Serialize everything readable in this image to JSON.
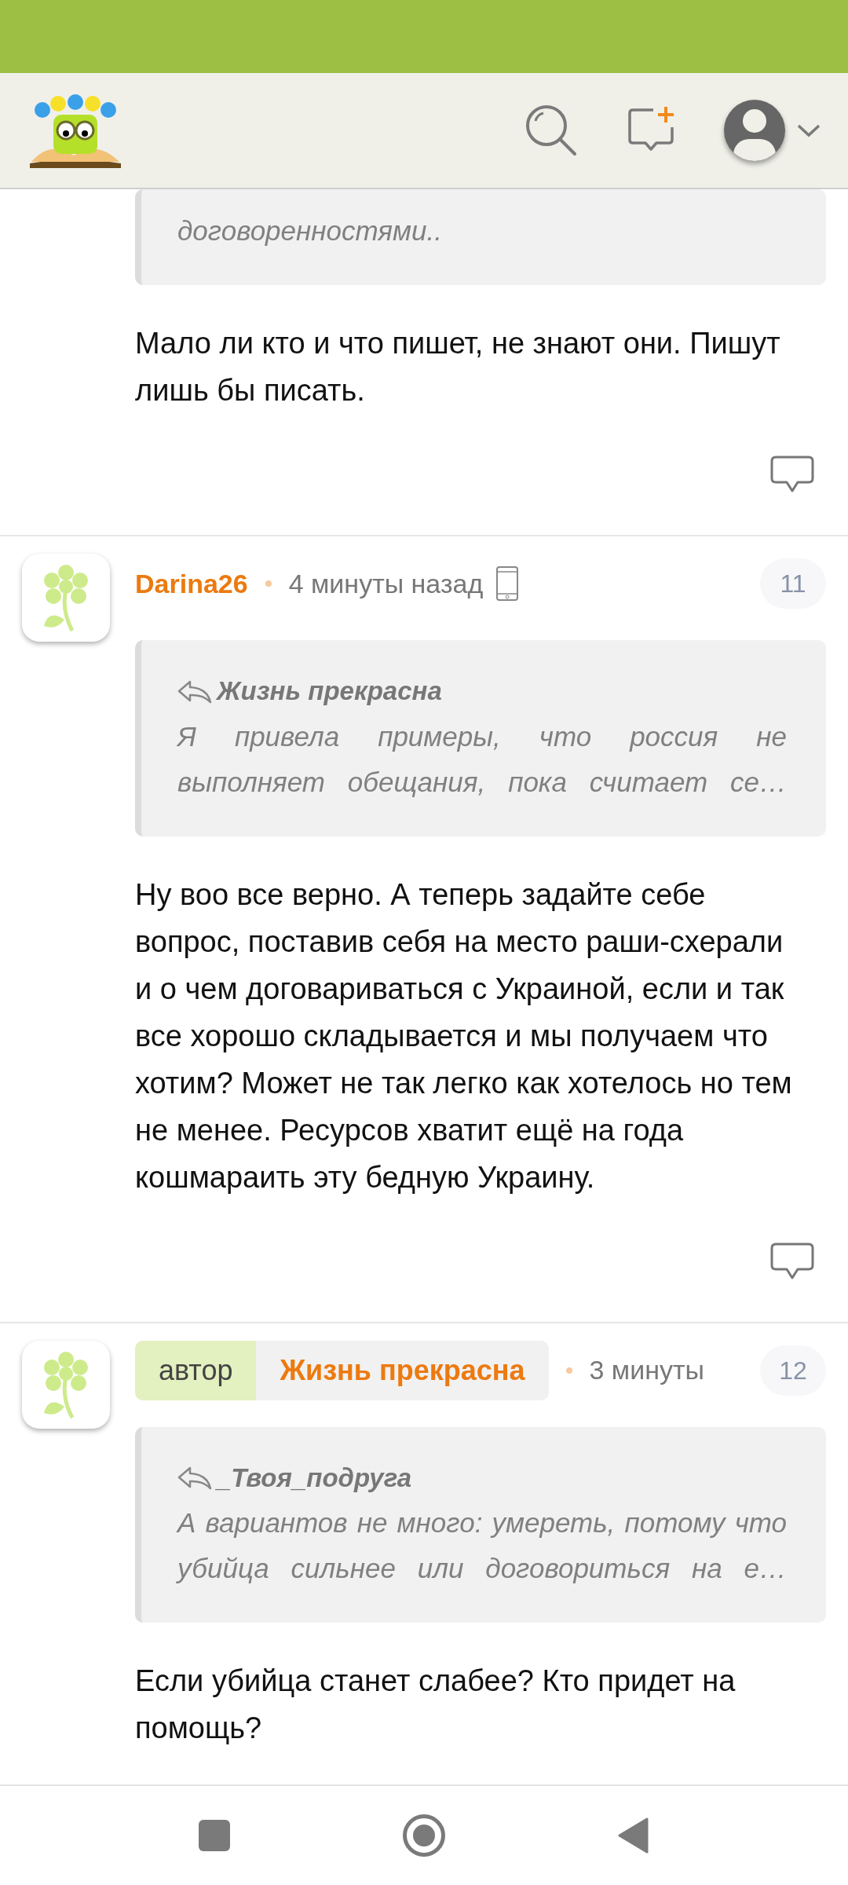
{
  "comments": [
    {
      "kind": "continued",
      "quote": {
        "text": "договоренностями.."
      },
      "body": "Мало ли кто и что пишет, не знают они. Пишут лишь бы писать.",
      "reply_button": true
    },
    {
      "kind": "full",
      "author": "Darina26",
      "time": "4 минуты назад",
      "mobile": true,
      "number": "11",
      "quote": {
        "author": "Жизнь прекрасна",
        "text": "Я привела примеры, что россия не выполняет обещания, пока считает се…"
      },
      "body": "Ну воо все верно. А теперь задайте себе вопрос, поставив себя на место раши-схерали и о чем договариваться с Украиной, если и так все хорошо складывается и мы получаем что хотим? Может не так легко как хотелось но тем не менее. Ресурсов хватит ещё на года кошмараить эту бедную Украину.",
      "reply_button": true
    },
    {
      "kind": "full",
      "badge": "автор",
      "author": "Жизнь прекрасна",
      "time": "3 минуты",
      "number": "12",
      "quote": {
        "author": "_Твоя_подруга",
        "text": "А вариантов не много: умереть, потому что убийца сильнее или договориться на е…"
      },
      "body": "Если убийца станет слабее? Кто придет на помощь?",
      "reply_button": false
    }
  ]
}
